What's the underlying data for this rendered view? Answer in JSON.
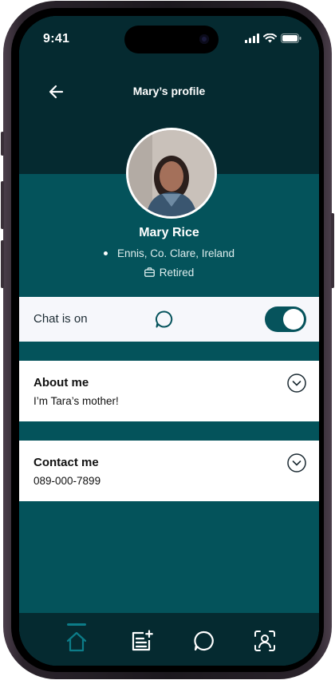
{
  "status_bar": {
    "time": "9:41"
  },
  "header": {
    "title": "Mary’s profile"
  },
  "profile": {
    "name": "Mary Rice",
    "location": "Ennis, Co. Clare, Ireland",
    "occupation": "Retired"
  },
  "chat": {
    "label": "Chat is on",
    "enabled": true
  },
  "sections": [
    {
      "title": "About me",
      "value": "I’m Tara’s mother!"
    },
    {
      "title": "Contact me",
      "value": "089-000-7899"
    }
  ],
  "tabbar": {
    "items": [
      "home-icon",
      "add-note-icon",
      "chat-icon",
      "profile-scan-icon"
    ],
    "active": "home-icon"
  },
  "colors": {
    "header_bg": "#052a30",
    "page_bg": "#04535b",
    "accent": "#06535c",
    "active_tab": "#0c7c88"
  }
}
